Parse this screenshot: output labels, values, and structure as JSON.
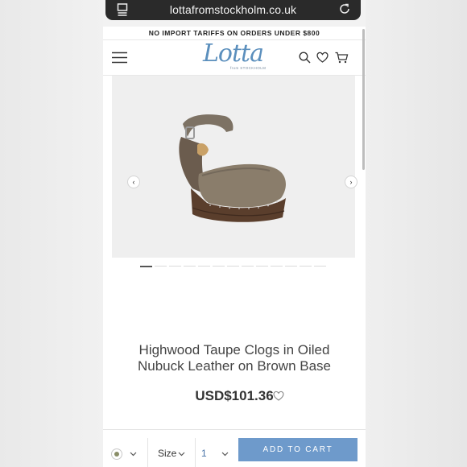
{
  "browser": {
    "url": "lottafromstockholm.co.uk"
  },
  "promo_banner": "NO IMPORT TARIFFS ON ORDERS UNDER $800",
  "header": {
    "logo_text": "Lotta",
    "logo_subtext": "from STOCKHOLM",
    "icons": [
      "menu-icon",
      "search-icon",
      "heart-icon",
      "cart-icon"
    ]
  },
  "gallery": {
    "prev_symbol": "‹",
    "next_symbol": "›",
    "slide_count": 13,
    "active_slide": 1
  },
  "product": {
    "title_line1": "Highwood Taupe Clogs in Oiled",
    "title_line2": "Nubuck Leather on Brown Base",
    "price": "USD$101.36"
  },
  "purchase_bar": {
    "color_swatch": "#8a8e68",
    "size_label": "Size",
    "quantity": "1",
    "add_to_cart_label": "ADD TO CART"
  },
  "colors": {
    "accent": "#6e9acb",
    "logo": "#5b8fbd"
  }
}
